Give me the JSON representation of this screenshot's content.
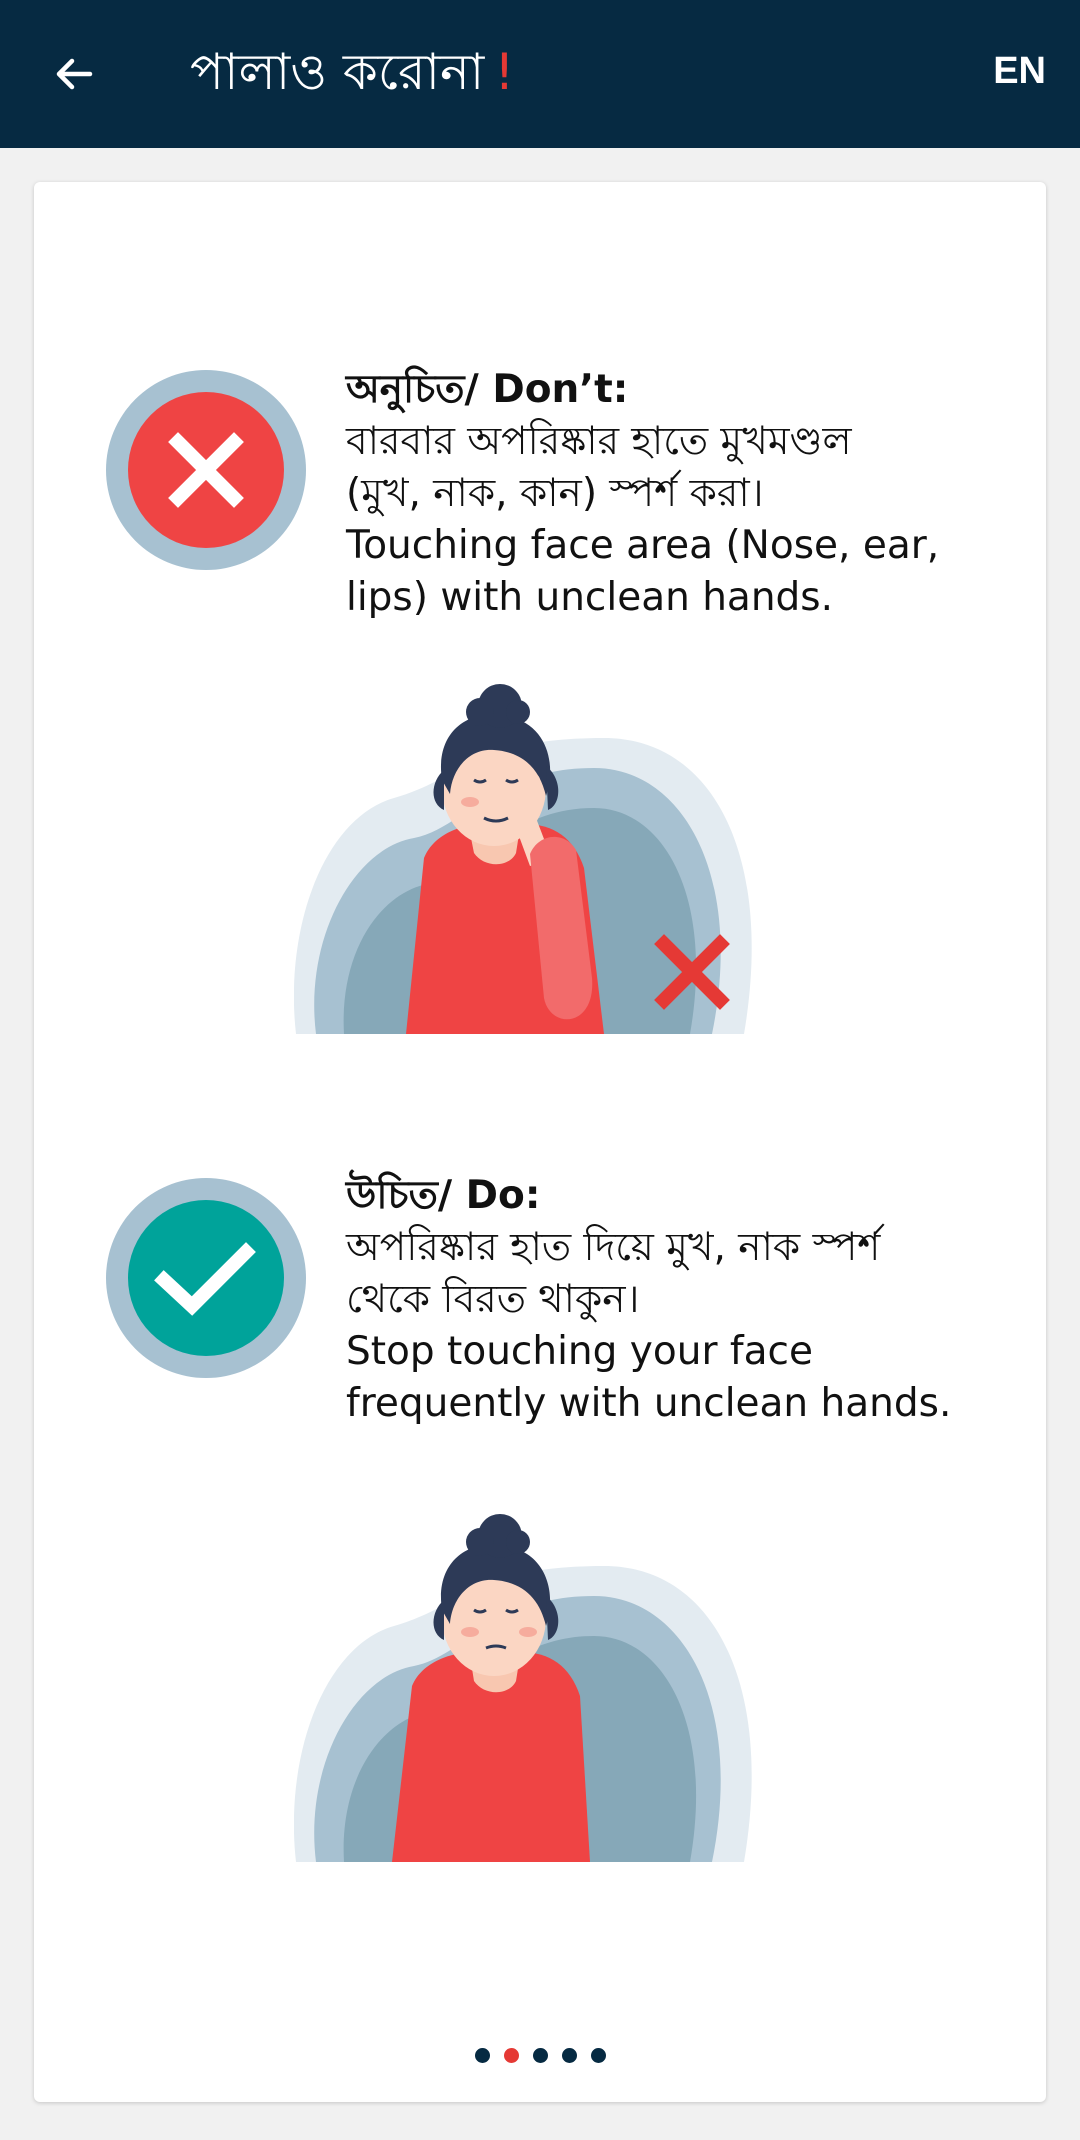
{
  "appbar": {
    "title": "পালাও করোনা",
    "title_suffix": "!",
    "language_label": "EN",
    "back_icon": "arrow-left-icon",
    "bg_color": "#062a42",
    "accent_color": "#e53935"
  },
  "dont": {
    "heading": "অনুচিত/ Don’t:",
    "bengali_line1": "বারবার অপরিষ্কার হাতে মুখমণ্ডল",
    "bengali_line2": "(মুখ, নাক, কান) স্পর্শ করা।",
    "english_line1": "Touching face area (Nose, ear,",
    "english_line2": "lips) with unclean hands.",
    "icon": "cross-icon",
    "color": "#ef4444"
  },
  "do": {
    "heading": "উচিত/ Do:",
    "bengali_line1": "অপরিষ্কার হাত দিয়ে মুখ, নাক স্পর্শ",
    "bengali_line2": "থেকে বিরত থাকুন।",
    "english_line1": "Stop touching your face",
    "english_line2": "frequently with unclean hands.",
    "icon": "check-icon",
    "color": "#00a39a"
  },
  "pager": {
    "count": 5,
    "active_index": 1
  }
}
